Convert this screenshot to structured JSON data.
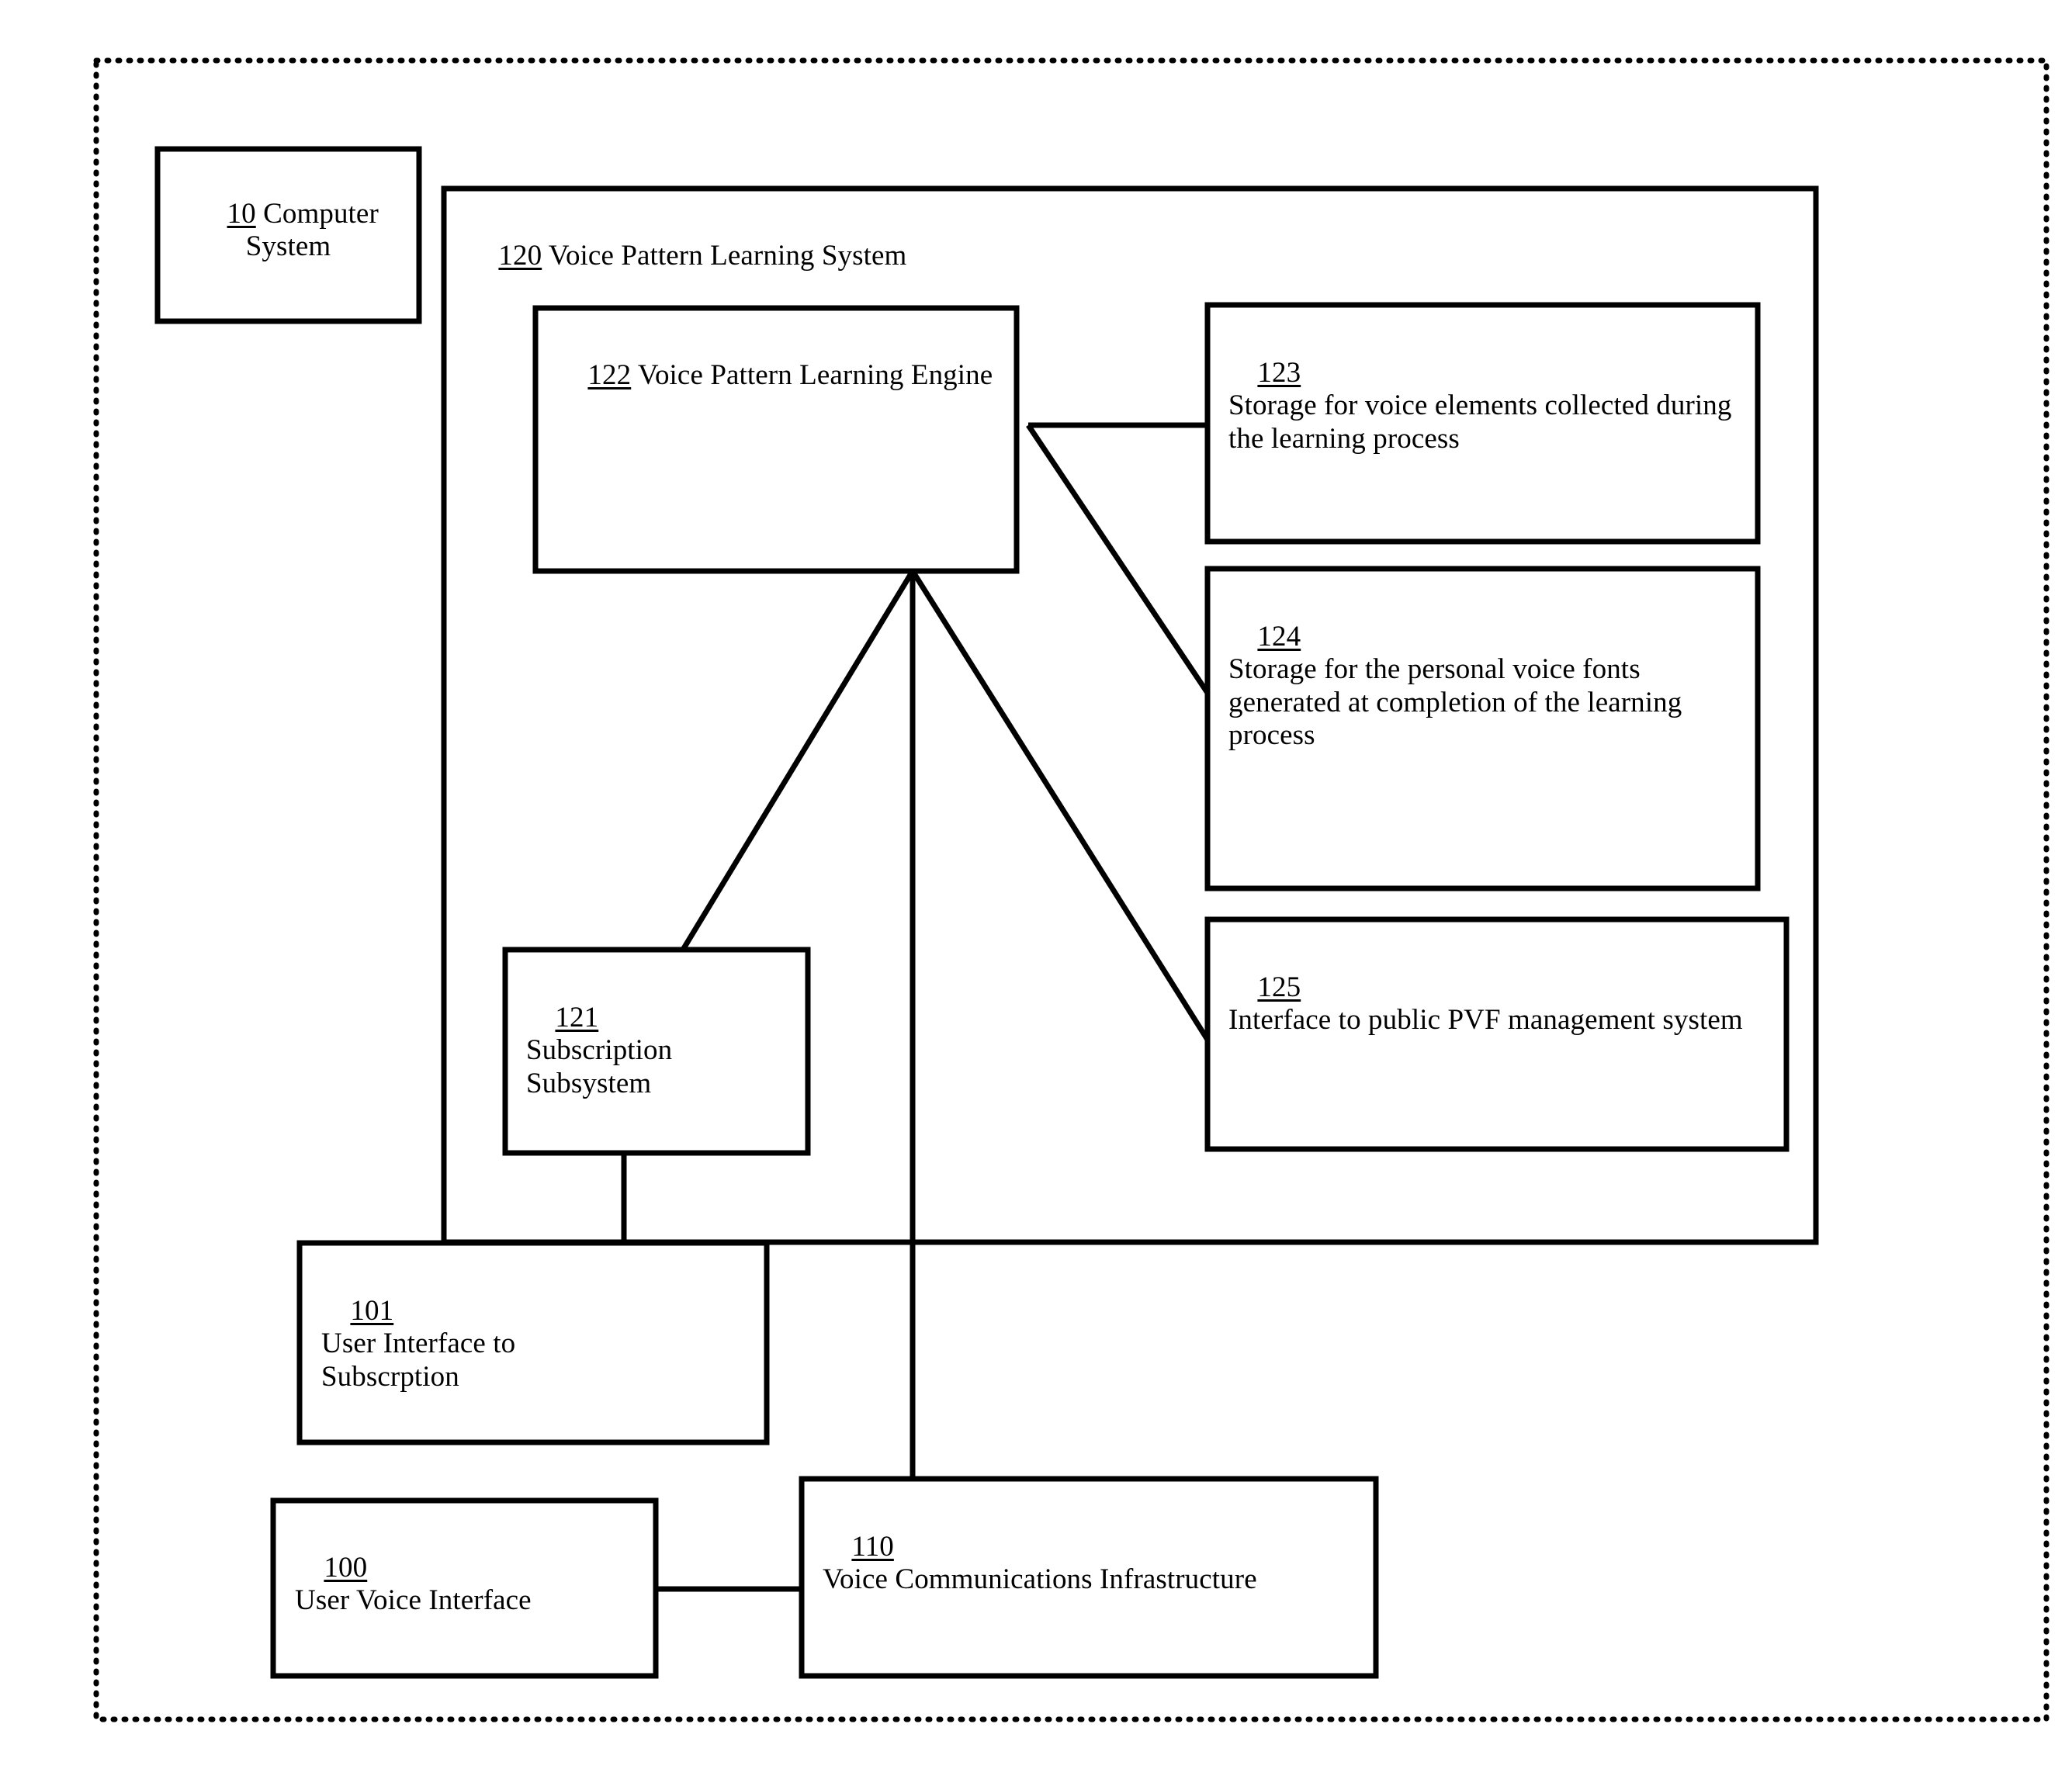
{
  "figure": {
    "background_color": "#ffffff",
    "line_color": "#000000",
    "outer_frame": "dotted-page-border"
  },
  "boxes": {
    "computer_system": {
      "ref": "10",
      "title": "Computer",
      "title_line2": "System",
      "full_text": "10 Computer System"
    },
    "voice_pattern_learning_system": {
      "ref": "120",
      "title": "Voice Pattern Learning System",
      "full_text": "120 Voice Pattern Learning System"
    },
    "voice_pattern_learning_engine": {
      "ref": "122",
      "title": "Voice Pattern Learning Engine",
      "full_text": "122 Voice Pattern Learning Engine"
    },
    "storage_voice_elements": {
      "ref": "123",
      "title": "Storage for voice elements collected during the learning process"
    },
    "storage_personal_voice_fonts": {
      "ref": "124",
      "title": "Storage for the personal voice fonts generated at completion of the learning process"
    },
    "interface_public_pvf": {
      "ref": "125",
      "title": "Interface to public PVF management system"
    },
    "subscription_subsystem": {
      "ref": "121",
      "title": "Subscription Subsystem"
    },
    "user_interface_subscription": {
      "ref": "101",
      "title": "User Interface to Subscrption"
    },
    "user_voice_interface": {
      "ref": "100",
      "title": "User Voice Interface"
    },
    "voice_communications_infrastructure": {
      "ref": "110",
      "title": "Voice Communications Infrastructure"
    }
  },
  "connectors": [
    {
      "name": "engine-to-storage-voice-elements",
      "from": "122",
      "to": "123"
    },
    {
      "name": "engine-to-storage-voice-fonts",
      "from": "122",
      "to": "124"
    },
    {
      "name": "engine-to-interface-pvf",
      "from": "122",
      "to": "125"
    },
    {
      "name": "engine-to-subscription-subsystem",
      "from": "122",
      "to": "121"
    },
    {
      "name": "engine-to-voice-communications",
      "from": "122",
      "to": "110"
    },
    {
      "name": "subscription-to-user-interface",
      "from": "121",
      "to": "101"
    },
    {
      "name": "user-voice-interface-to-voice-communications",
      "from": "100",
      "to": "110"
    }
  ]
}
